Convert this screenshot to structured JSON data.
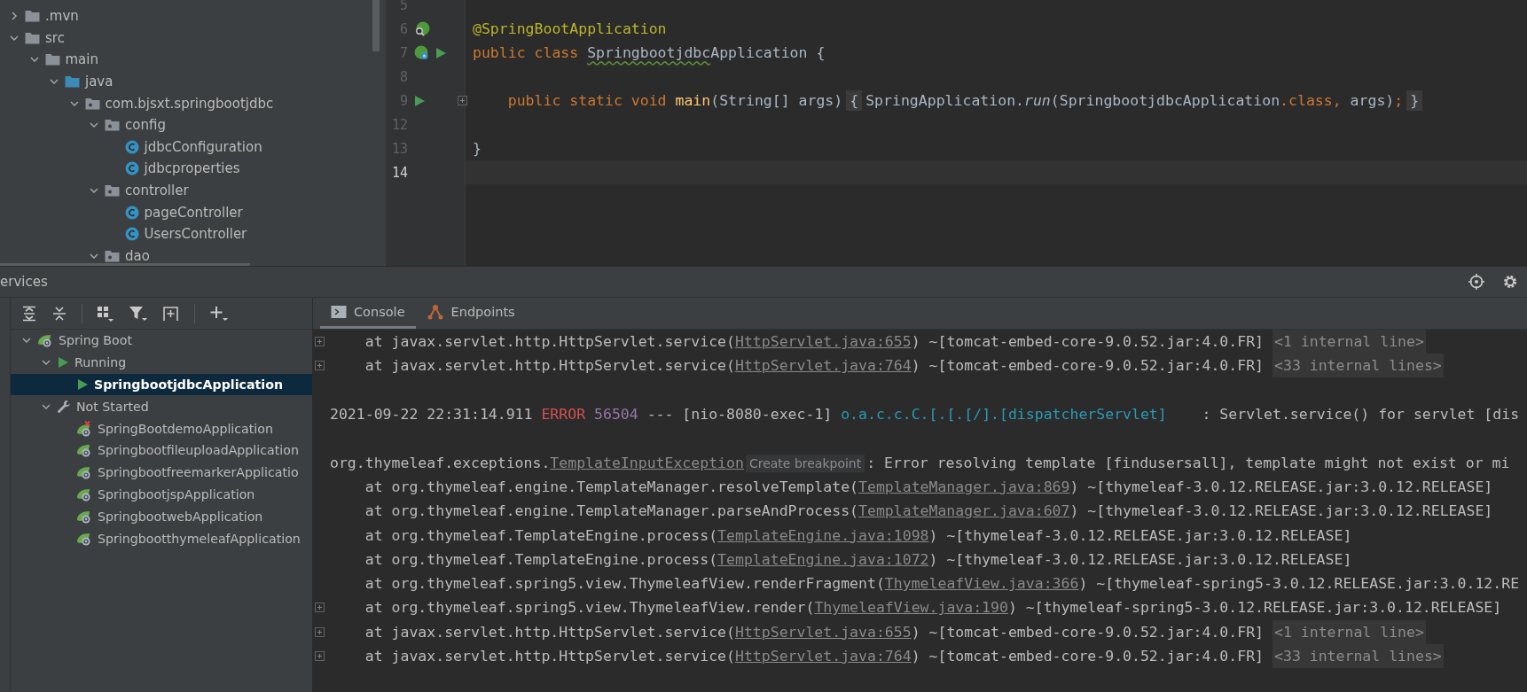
{
  "project_tree": {
    "items": [
      {
        "label": ".mvn",
        "kind": "folder",
        "expanded": false
      },
      {
        "label": "src",
        "kind": "folder",
        "expanded": true,
        "children": [
          {
            "label": "main",
            "kind": "folder",
            "expanded": true,
            "children": [
              {
                "label": "java",
                "kind": "source-folder",
                "expanded": true,
                "children": [
                  {
                    "label": "com.bjsxt.springbootjdbc",
                    "kind": "package",
                    "expanded": true,
                    "children": [
                      {
                        "label": "config",
                        "kind": "package",
                        "expanded": true,
                        "children": [
                          {
                            "label": "jdbcConfiguration",
                            "kind": "class"
                          },
                          {
                            "label": "jdbcproperties",
                            "kind": "class"
                          }
                        ]
                      },
                      {
                        "label": "controller",
                        "kind": "package",
                        "expanded": true,
                        "children": [
                          {
                            "label": "pageController",
                            "kind": "class"
                          },
                          {
                            "label": "UsersController",
                            "kind": "class"
                          }
                        ]
                      },
                      {
                        "label": "dao",
                        "kind": "package",
                        "expanded": true
                      }
                    ]
                  }
                ]
              }
            ]
          }
        ]
      }
    ]
  },
  "editor": {
    "lines": [
      {
        "number": "5",
        "current": false
      },
      {
        "number": "6",
        "current": false,
        "gutter": [
          {
            "kind": "spring-search"
          }
        ],
        "segments": [
          {
            "kind": "annotation",
            "text": "@SpringBootApplication"
          }
        ]
      },
      {
        "number": "7",
        "current": false,
        "gutter": [
          {
            "kind": "spring-bean"
          },
          {
            "kind": "run"
          }
        ],
        "segments": [
          {
            "kind": "keyword",
            "text": "public class "
          },
          {
            "kind": "typo",
            "text": "Springbootjdbc"
          },
          {
            "kind": "plain",
            "text": "Application {"
          }
        ]
      },
      {
        "number": "8",
        "current": false
      },
      {
        "number": "9",
        "current": false,
        "gutter": [
          {
            "kind": "run"
          }
        ],
        "fold": true,
        "segments": [
          {
            "kind": "keyword",
            "text": "    public static void "
          },
          {
            "kind": "method",
            "text": "main"
          },
          {
            "kind": "plain",
            "text": "(String[] args)"
          },
          {
            "kind": "folded",
            "text": "{"
          },
          {
            "kind": "plain",
            "text": "SpringApplication."
          },
          {
            "kind": "italic",
            "text": "run"
          },
          {
            "kind": "plain",
            "text": "(SpringbootjdbcApplication"
          },
          {
            "kind": "keyword",
            "text": ".class,"
          },
          {
            "kind": "plain",
            "text": " args)"
          },
          {
            "kind": "keyword",
            "text": ";"
          },
          {
            "kind": "folded",
            "text": "}"
          }
        ]
      },
      {
        "number": "12",
        "current": false
      },
      {
        "number": "13",
        "current": false,
        "segments": [
          {
            "kind": "plain",
            "text": "}"
          }
        ]
      },
      {
        "number": "14",
        "current": true
      }
    ]
  },
  "services": {
    "title": "ervices",
    "tree": [
      {
        "label": "Spring Boot",
        "kind": "spring",
        "expanded": true,
        "selected": false,
        "children": [
          {
            "label": "Running",
            "kind": "run",
            "expanded": true,
            "selected": false,
            "children": [
              {
                "label": "SpringbootjdbcApplication",
                "kind": "run",
                "selected": true
              }
            ]
          },
          {
            "label": "Not Started",
            "kind": "wrench",
            "expanded": true,
            "selected": false,
            "children": [
              {
                "label": "SpringBootdemoApplication",
                "kind": "spring-error",
                "selected": false
              },
              {
                "label": "SpringbootfileuploadApplication",
                "kind": "spring",
                "selected": false
              },
              {
                "label": "SpringbootfreemarkerApplicatio",
                "kind": "spring",
                "selected": false
              },
              {
                "label": "SpringbootjspApplication",
                "kind": "spring",
                "selected": false
              },
              {
                "label": "SpringbootwebApplication",
                "kind": "spring",
                "selected": false
              },
              {
                "label": "SpringbootthymeleafApplication",
                "kind": "spring",
                "selected": false
              }
            ]
          }
        ]
      }
    ]
  },
  "console": {
    "tabs": [
      {
        "label": "Console",
        "kind": "console",
        "selected": true
      },
      {
        "label": "Endpoints",
        "kind": "endpoints",
        "selected": false
      }
    ],
    "lines": [
      {
        "fold": true,
        "segments": [
          {
            "kind": "plain",
            "text": "    at javax.servlet.http.HttpServlet.service("
          },
          {
            "kind": "link",
            "text": "HttpServlet.java:655"
          },
          {
            "kind": "plain",
            "text": ") ~[tomcat-embed-core-9.0.52.jar:4.0.FR]"
          },
          {
            "kind": "collapsed",
            "text": "<1 internal line>"
          }
        ]
      },
      {
        "fold": true,
        "segments": [
          {
            "kind": "plain",
            "text": "    at javax.servlet.http.HttpServlet.service("
          },
          {
            "kind": "link",
            "text": "HttpServlet.java:764"
          },
          {
            "kind": "plain",
            "text": ") ~[tomcat-embed-core-9.0.52.jar:4.0.FR]"
          },
          {
            "kind": "collapsed",
            "text": "<33 internal lines>"
          }
        ]
      },
      {
        "fold": false
      },
      {
        "fold": false,
        "segments": [
          {
            "kind": "plain",
            "text": "2021-09-22 22:31:14.911 "
          },
          {
            "kind": "error",
            "text": "ERROR"
          },
          {
            "kind": "pid",
            "text": " 56504"
          },
          {
            "kind": "plain",
            "text": " --- [nio-8080-exec-1] "
          },
          {
            "kind": "logger",
            "text": "o.a.c.c.C.[.[.[/].[dispatcherServlet]"
          },
          {
            "kind": "plain",
            "text": "    : Servlet.service() for servlet [dis"
          }
        ]
      },
      {
        "fold": false
      },
      {
        "fold": false,
        "segments": [
          {
            "kind": "plain",
            "text": "org.thymeleaf.exceptions."
          },
          {
            "kind": "link",
            "text": "TemplateInputException"
          },
          {
            "kind": "hint",
            "text": "Create breakpoint"
          },
          {
            "kind": "plain",
            "text": ": Error resolving template [findusersall], template might not exist or mi"
          }
        ]
      },
      {
        "fold": false,
        "segments": [
          {
            "kind": "plain",
            "text": "    at org.thymeleaf.engine.TemplateManager.resolveTemplate("
          },
          {
            "kind": "link",
            "text": "TemplateManager.java:869"
          },
          {
            "kind": "plain",
            "text": ") ~[thymeleaf-3.0.12.RELEASE.jar:3.0.12.RELEASE]"
          }
        ]
      },
      {
        "fold": false,
        "segments": [
          {
            "kind": "plain",
            "text": "    at org.thymeleaf.engine.TemplateManager.parseAndProcess("
          },
          {
            "kind": "link",
            "text": "TemplateManager.java:607"
          },
          {
            "kind": "plain",
            "text": ") ~[thymeleaf-3.0.12.RELEASE.jar:3.0.12.RELEASE]"
          }
        ]
      },
      {
        "fold": false,
        "segments": [
          {
            "kind": "plain",
            "text": "    at org.thymeleaf.TemplateEngine.process("
          },
          {
            "kind": "link",
            "text": "TemplateEngine.java:1098"
          },
          {
            "kind": "plain",
            "text": ") ~[thymeleaf-3.0.12.RELEASE.jar:3.0.12.RELEASE]"
          }
        ]
      },
      {
        "fold": false,
        "segments": [
          {
            "kind": "plain",
            "text": "    at org.thymeleaf.TemplateEngine.process("
          },
          {
            "kind": "link",
            "text": "TemplateEngine.java:1072"
          },
          {
            "kind": "plain",
            "text": ") ~[thymeleaf-3.0.12.RELEASE.jar:3.0.12.RELEASE]"
          }
        ]
      },
      {
        "fold": false,
        "segments": [
          {
            "kind": "plain",
            "text": "    at org.thymeleaf.spring5.view.ThymeleafView.renderFragment("
          },
          {
            "kind": "link",
            "text": "ThymeleafView.java:366"
          },
          {
            "kind": "plain",
            "text": ") ~[thymeleaf-spring5-3.0.12.RELEASE.jar:3.0.12.RE"
          }
        ]
      },
      {
        "fold": true,
        "segments": [
          {
            "kind": "plain",
            "text": "    at org.thymeleaf.spring5.view.ThymeleafView.render("
          },
          {
            "kind": "link",
            "text": "ThymeleafView.java:190"
          },
          {
            "kind": "plain",
            "text": ") ~[thymeleaf-spring5-3.0.12.RELEASE.jar:3.0.12.RELEASE]"
          }
        ]
      },
      {
        "fold": true,
        "segments": [
          {
            "kind": "plain",
            "text": "    at javax.servlet.http.HttpServlet.service("
          },
          {
            "kind": "link",
            "text": "HttpServlet.java:655"
          },
          {
            "kind": "plain",
            "text": ") ~[tomcat-embed-core-9.0.52.jar:4.0.FR]"
          },
          {
            "kind": "collapsed",
            "text": "<1 internal line>"
          }
        ]
      },
      {
        "fold": true,
        "segments": [
          {
            "kind": "plain",
            "text": "    at javax.servlet.http.HttpServlet.service("
          },
          {
            "kind": "link",
            "text": "HttpServlet.java:764"
          },
          {
            "kind": "plain",
            "text": ") ~[tomcat-embed-core-9.0.52.jar:4.0.FR]"
          },
          {
            "kind": "collapsed",
            "text": "<33 internal lines>"
          }
        ]
      }
    ]
  }
}
